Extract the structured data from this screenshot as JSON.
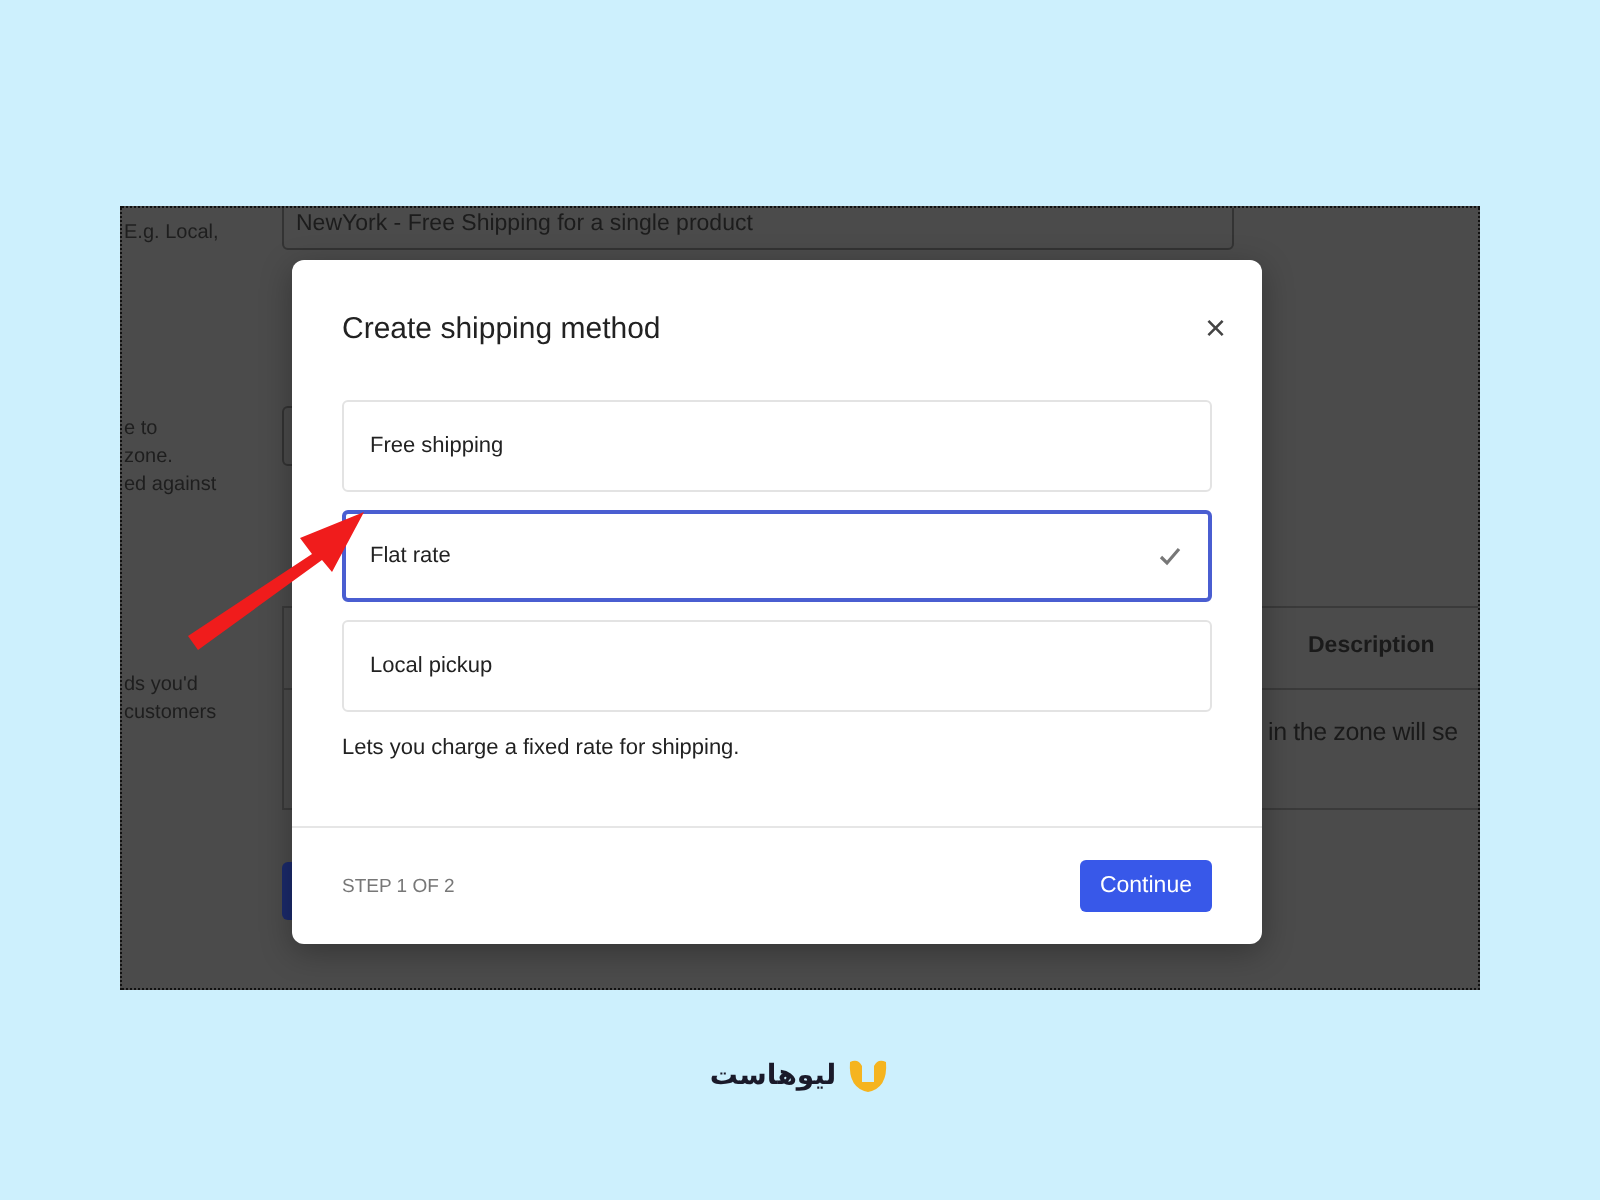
{
  "background_page": {
    "hint_groups": [
      [
        "E.g. Local,"
      ],
      [
        "e to",
        "zone.",
        "ed against"
      ],
      [
        "ds you'd",
        "customers"
      ]
    ],
    "name_field": {
      "value": "NewYork - Free Shipping for a single product"
    },
    "table": {
      "columns": [
        "Description"
      ],
      "cell": "in the zone will se"
    }
  },
  "dialog": {
    "title": "Create shipping method",
    "close": "×",
    "options": [
      {
        "label": "Free shipping",
        "selected": false
      },
      {
        "label": "Flat rate",
        "selected": true
      },
      {
        "label": "Local pickup",
        "selected": false
      }
    ],
    "description": "Lets you charge a fixed rate for shipping.",
    "step": "STEP 1 OF 2",
    "buttons": [
      "Continue"
    ]
  },
  "logo": {
    "text": "لیوهاست"
  }
}
